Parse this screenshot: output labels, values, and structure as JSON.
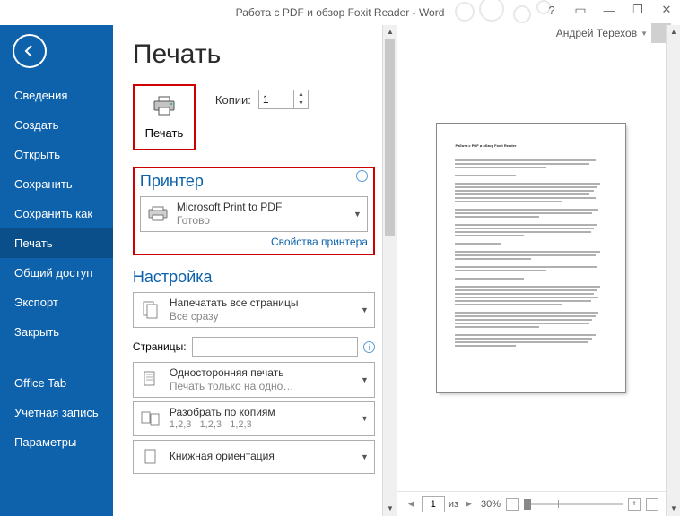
{
  "titlebar": {
    "title": "Работа с PDF и обзор Foxit Reader - Word",
    "user": "Андрей Терехов"
  },
  "sidebar": {
    "items": [
      {
        "label": "Сведения"
      },
      {
        "label": "Создать"
      },
      {
        "label": "Открыть"
      },
      {
        "label": "Сохранить"
      },
      {
        "label": "Сохранить как"
      },
      {
        "label": "Печать"
      },
      {
        "label": "Общий доступ"
      },
      {
        "label": "Экспорт"
      },
      {
        "label": "Закрыть"
      },
      {
        "label": "Office Tab"
      },
      {
        "label": "Учетная запись"
      },
      {
        "label": "Параметры"
      }
    ]
  },
  "print": {
    "heading": "Печать",
    "button_label": "Печать",
    "copies_label": "Копии:",
    "copies_value": "1",
    "printer_section": "Принтер",
    "printer_name": "Microsoft Print to PDF",
    "printer_status": "Готово",
    "printer_props_link": "Свойства принтера",
    "settings_section": "Настройка",
    "print_all_label": "Напечатать все страницы",
    "print_all_sub": "Все сразу",
    "pages_label": "Страницы:",
    "sides_label": "Односторонняя печать",
    "sides_sub": "Печать только на одно…",
    "collate_label": "Разобрать по копиям",
    "collate_sub1": "1,2,3",
    "collate_sub2": "1,2,3",
    "collate_sub3": "1,2,3",
    "orientation_label": "Книжная ориентация"
  },
  "preview": {
    "doc_title": "Работа с PDF и обзор Foxit Reader",
    "current_page": "1",
    "page_of_label": "из",
    "zoom_label": "30%"
  }
}
